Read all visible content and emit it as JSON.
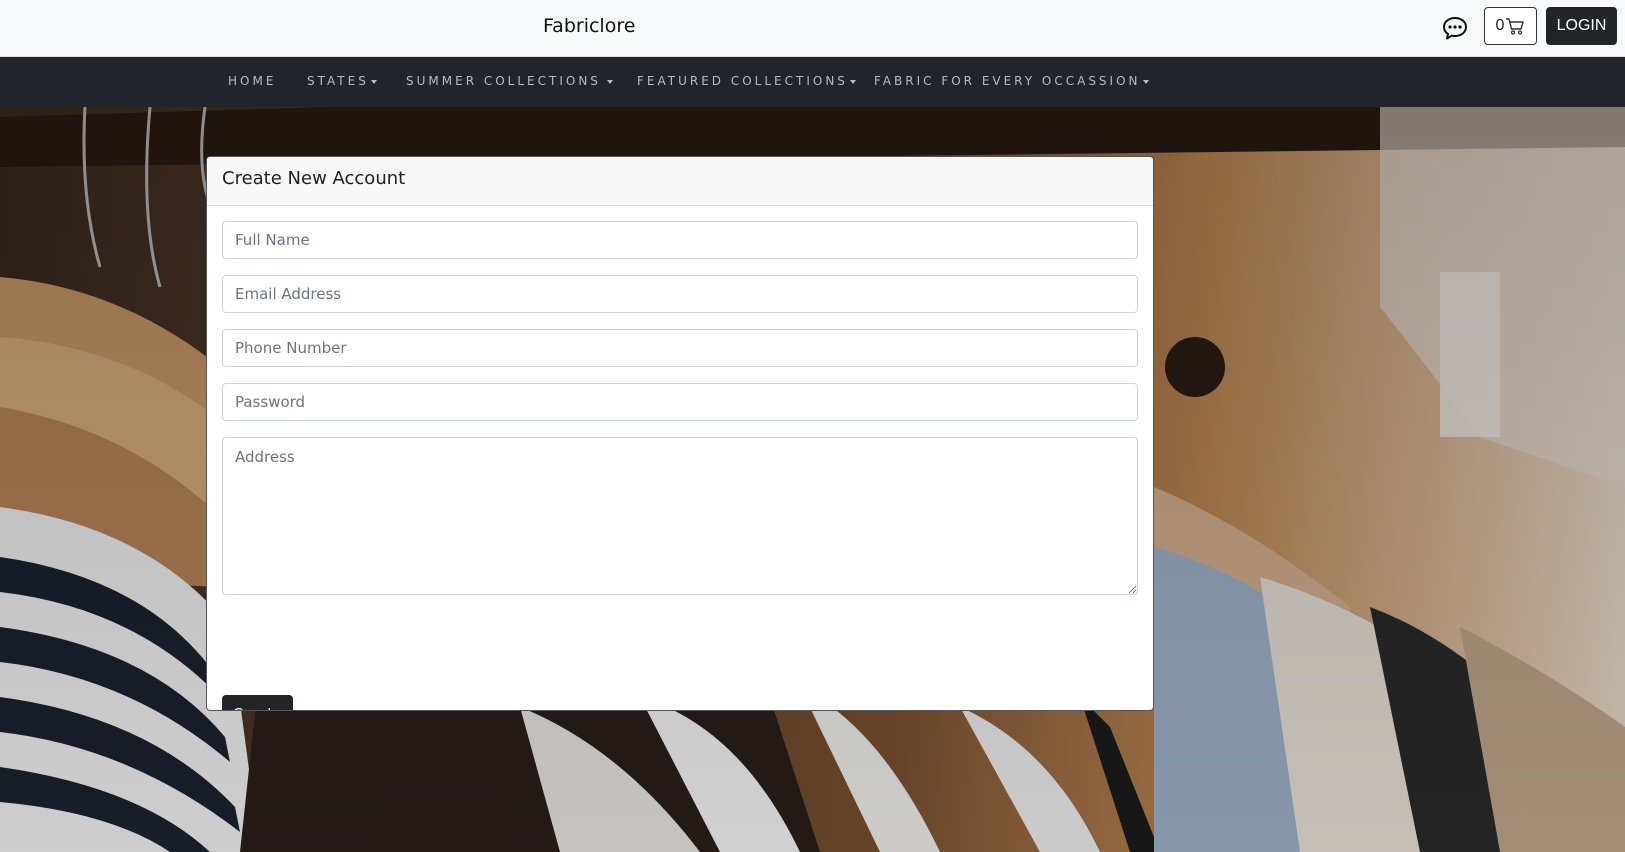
{
  "header": {
    "brand": "Fabriclore",
    "cart_count": "0",
    "login_label": "LOGIN",
    "icons": {
      "chat": "chat-bubble-icon",
      "cart": "shopping-cart-icon"
    }
  },
  "nav": {
    "items": [
      {
        "label": "HOME",
        "dropdown": false
      },
      {
        "label": "STATES",
        "dropdown": true
      },
      {
        "label": "SUMMER COLLECTIONS",
        "dropdown": true
      },
      {
        "label": "FEATURED COLLECTIONS",
        "dropdown": true
      },
      {
        "label": "FABRIC FOR EVERY OCCASSION",
        "dropdown": true
      }
    ]
  },
  "form": {
    "title": "Create New Account",
    "fields": {
      "full_name": {
        "value": "",
        "placeholder": "Full Name"
      },
      "email": {
        "value": "",
        "placeholder": "Email Address"
      },
      "phone": {
        "value": "",
        "placeholder": "Phone Number"
      },
      "password": {
        "value": "",
        "placeholder": "Password"
      },
      "address": {
        "value": "",
        "placeholder": "Address"
      }
    },
    "submit_label": "Create"
  },
  "colors": {
    "navbar_bg": "#212529",
    "topbar_bg": "#f8f9fa",
    "button_dark": "#212529",
    "nav_text": "#b8bcc0"
  }
}
